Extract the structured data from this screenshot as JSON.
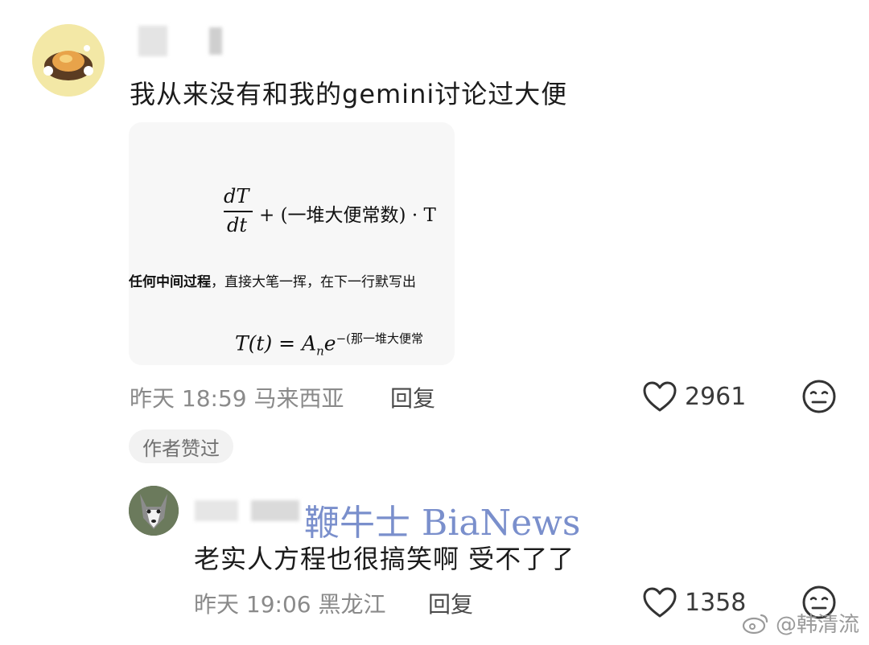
{
  "comments": [
    {
      "text": "我从来没有和我的gemini讨论过大便",
      "image": {
        "eq1_num": "dT",
        "eq1_den": "dt",
        "eq1_rest": "+ (一堆大便常数) · T",
        "mid_bold": "任何中间过程",
        "mid_rest": "，直接大笔一挥，在下一行默写出",
        "eq2_lhs": "T(t) = A",
        "eq2_sub": "n",
        "eq2_e": "e",
        "eq2_sup": "−(那一堆大便常"
      },
      "time": "昨天 18:59",
      "location": "马来西亚",
      "reply_label": "回复",
      "likes": "2961",
      "author_liked_badge": "作者赞过"
    },
    {
      "text": "老实人方程也很搞笑啊 受不了了",
      "time": "昨天 19:06",
      "location": "黑龙江",
      "reply_label": "回复",
      "likes": "1358"
    }
  ],
  "watermark": "鞭牛士 BiaNews",
  "weibo_watermark": "@韩清流",
  "icons": {
    "like": "heart-outline-icon",
    "reaction": "meh-face-icon",
    "weibo": "weibo-logo-icon"
  },
  "colors": {
    "watermark": "#6f86c8",
    "meta_gray": "#8a8a8a",
    "avatar1_bg": "#f3e8a6"
  }
}
